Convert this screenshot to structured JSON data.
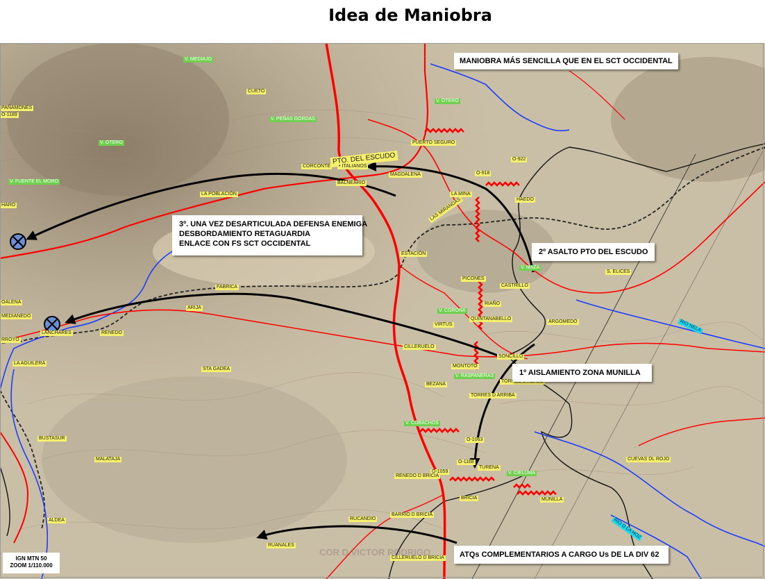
{
  "title": "Idea de Maniobra",
  "callouts": {
    "top": "MANIOBRA MÁS SENCILLA QUE EN EL SCT OCCIDENTAL",
    "phase3_line1": "3º. UNA VEZ DESARTICULADA DEFENSA ENEMIGA",
    "phase3_line2": "DESBORDAMIENTO RETAGUARDIA",
    "phase3_line3": "ENLACE CON FS SCT OCCIDENTAL",
    "phase2": "2º ASALTO PTO DEL ESCUDO",
    "phase1": "1º AISLAMIENTO ZONA MUNILLA",
    "atq": "ATQs COMPLEMENTARIOS A CARGO Us DE LA DIV 62"
  },
  "pto_escudo": "PTO. DEL ESCUDO",
  "scale": {
    "line1": "IGN MTN 50",
    "line2": "ZOOM 1/110.000"
  },
  "watermark": "COR D.VICTOR RODRIGO",
  "labels_yellow": {
    "cueto": "CUETO",
    "corconte": "CORCONTE",
    "italianos": "• ITALIANOS",
    "magdalena": "MAGDALENA",
    "balneario": "BALNEARIO",
    "puerto_seguro": "PUERTO SEGURO",
    "la_poblacion": "LA POBLACIÓN",
    "mirandas": "LAS MIRANDAS",
    "la_mina": "LA MINA",
    "o918": "O-918",
    "o922": "O-922",
    "haedo": "HAEDO",
    "estacion": "ESTACIÓN",
    "picones": "PICONES",
    "castrillo": "CASTRILLO",
    "riano": "RIAÑO",
    "virtus": "VIRTUS",
    "santamarina": "SANTAMARINA",
    "quintanabello": "QUINTANABELLO",
    "cillerue": "CILLERUELO",
    "soncillo": "SONCILLO",
    "argomedo": "ARGOMEDO",
    "fabrica": "FABRICA",
    "arija": "ARIJA",
    "renedo": "RENEDO",
    "montoto": "MONTOTO",
    "torres_abajo": "TORRES D ABAJO",
    "torres_arriba": "TORRES D ARRIBA",
    "bezana": "BEZANA",
    "o1063": "O-1063",
    "o1168": "O-1168",
    "o1059": "O-1059",
    "turena": "TURENA",
    "renedo_bricia": "RENEDO D BRICIA",
    "bricia": "BRICIA",
    "munilla": "MUNILLA",
    "cuevas_rojo": "CUEVAS DL ROJO",
    "barrio_bricia": "BARRIO D BRICIA",
    "rucandio": "RUCANDIO",
    "ruanales": "RUANALES",
    "cillerue2": "CILLERUELO D BRICIA",
    "sta_gadea": "STA GADEA",
    "la_aguilera": "LA AGUILERA",
    "bustasur": "BUSTASUR",
    "malataja": "MALATAJA",
    "aldea": "ALDEA",
    "medianedo": "MEDIANEDO",
    "olalena": "OALENA",
    "paramos": "PAÑAMONES",
    "o1189": "O-1189",
    "haro": "HARO",
    "royo": "RROYO",
    "lanchares": "LANCHARES",
    "s_elices": "S. ELICES"
  },
  "labels_green": {
    "mediajo": "V. MEDIAJO",
    "penas_gordas": "V. PEÑAS GORDAS",
    "otero_w": "V. OTERO",
    "fuente_moro": "V. FUENTE EL MORO",
    "otero_n": "V. OTERO",
    "maza": "V. MAZA",
    "corona": "V. CORONA",
    "raspaneras": "V. RASPANERAS",
    "cobachos": "V. COBACHOS",
    "cieluma": "V. CIELUMA"
  },
  "labels_cyan": {
    "rio_nela": "RIO NELA",
    "rio_hoz": "RIO D LA HOZ"
  }
}
